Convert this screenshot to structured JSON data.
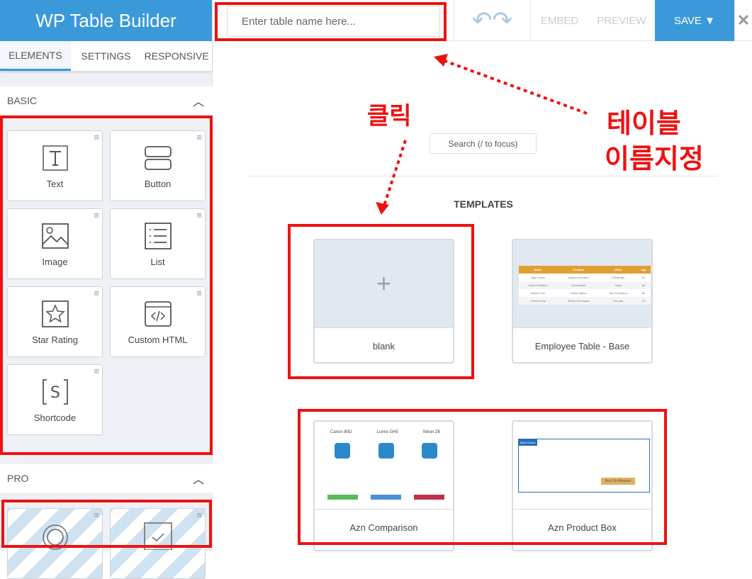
{
  "sidebar": {
    "brand": "WP Table Builder",
    "tabs": [
      {
        "label": "ELEMENTS",
        "active": true
      },
      {
        "label": "SETTINGS"
      },
      {
        "label": "RESPONSIVE"
      }
    ],
    "basic": {
      "title": "BASIC",
      "items": [
        {
          "label": "Text",
          "icon": "text-icon"
        },
        {
          "label": "Button",
          "icon": "button-icon"
        },
        {
          "label": "Image",
          "icon": "image-icon"
        },
        {
          "label": "List",
          "icon": "list-icon"
        },
        {
          "label": "Star Rating",
          "icon": "star-icon"
        },
        {
          "label": "Custom HTML",
          "icon": "code-icon"
        },
        {
          "label": "Shortcode",
          "icon": "shortcode-icon"
        }
      ]
    },
    "pro": {
      "title": "PRO",
      "items": [
        {
          "icon": "circle-progress-icon"
        },
        {
          "icon": "checkbox-icon"
        }
      ]
    }
  },
  "topbar": {
    "name_placeholder": "Enter table name here...",
    "embed": "EMBED",
    "preview": "PREVIEW",
    "save": "SAVE ▼",
    "close": "✕"
  },
  "main": {
    "search_placeholder": "Search (/ to focus)",
    "templates_heading": "TEMPLATES",
    "templates": [
      {
        "label": "blank"
      },
      {
        "label": "Employee Table - Base",
        "table": {
          "headers": [
            "Name",
            "Position",
            "Office",
            "Age"
          ],
          "rows": [
            [
              "Tiger Nixon",
              "System Architect",
              "Edinburgh",
              "61"
            ],
            [
              "Garrett Winters",
              "Accountant",
              "Tokyo",
              "63"
            ],
            [
              "Ashton Cox",
              "Junior Author",
              "San Francisco",
              "66"
            ],
            [
              "Cedric Kelly",
              "Senior Developer",
              "Remote",
              "22"
            ]
          ]
        }
      },
      {
        "label": "Azn Comparison",
        "products": [
          "Canon 80D",
          "Lumix GH5",
          "Nikon Z6"
        ]
      },
      {
        "label": "Azn Product Box",
        "badge": "Best Choice",
        "button": "Buy On Amazon"
      }
    ]
  },
  "annotations": {
    "click": "클릭",
    "name_line1": "테이블",
    "name_line2": "이름지정"
  },
  "colors": {
    "accent": "#3a9ad9",
    "annotation": "#ee1111",
    "table_header": "#e0a030"
  }
}
